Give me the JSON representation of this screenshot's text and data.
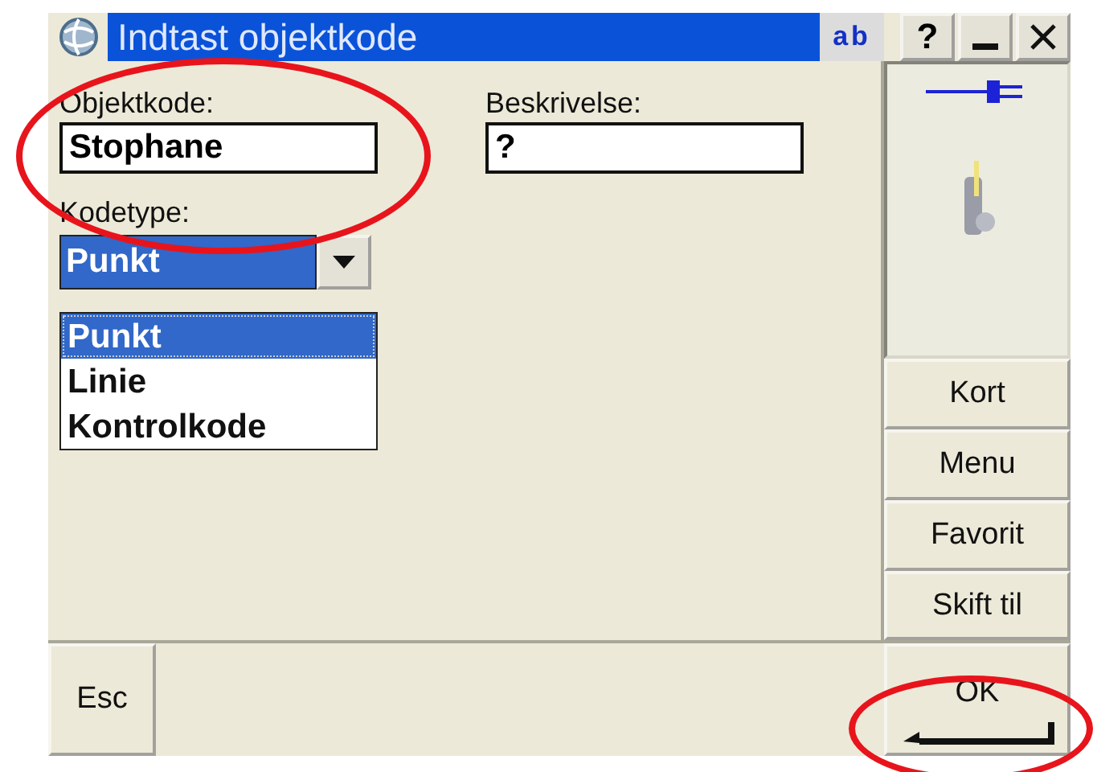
{
  "window": {
    "title": "Indtast objektkode",
    "input_mode": "ab",
    "help_button": "?"
  },
  "fields": [
    {
      "label": "Objektkode:",
      "value": "Stophane"
    },
    {
      "label": "Beskrivelse:",
      "value": "?"
    }
  ],
  "code_type": {
    "label": "Kodetype:",
    "value": "Punkt",
    "expanded": true,
    "options": [
      {
        "label": "Punkt",
        "selected": true
      },
      {
        "label": "Linie",
        "selected": false
      },
      {
        "label": "Kontrolkode",
        "selected": false
      }
    ]
  },
  "side_buttons": [
    "Kort",
    "Menu",
    "Favorit",
    "Skift til"
  ],
  "bottom_buttons": [
    {
      "kind": "esc",
      "label": "Esc"
    },
    {
      "kind": "ok",
      "label": "OK"
    }
  ],
  "annotations": [
    {
      "kind": "ellipse"
    },
    {
      "kind": "ellipse"
    }
  ]
}
